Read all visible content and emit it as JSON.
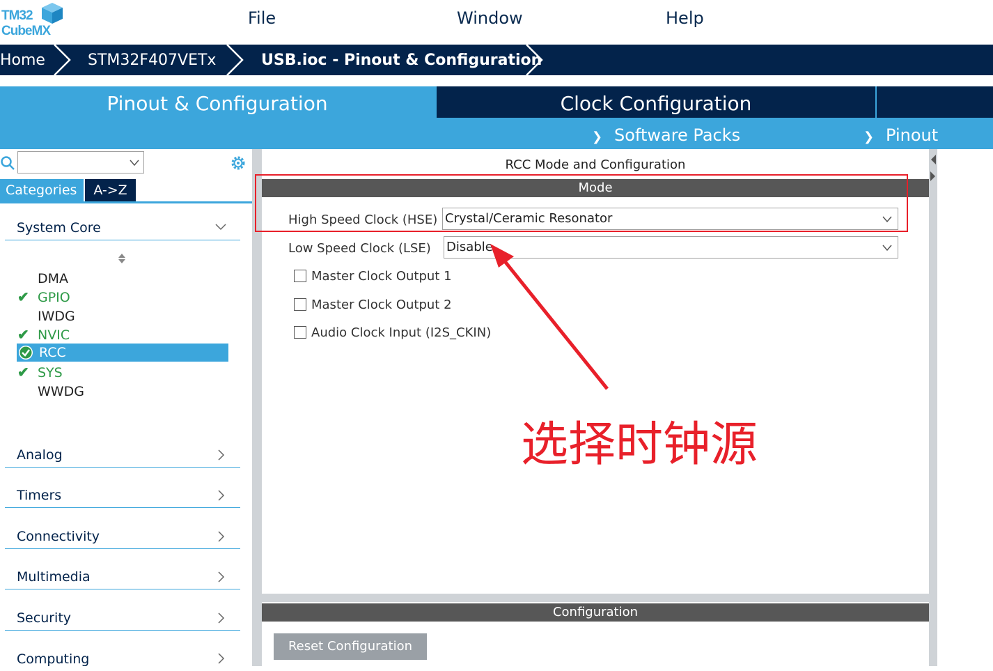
{
  "app": {
    "logo_line1": "TM32",
    "logo_line2": "CubeMX",
    "menu": [
      "File",
      "Window",
      "Help"
    ]
  },
  "breadcrumb": [
    "Home",
    "STM32F407VETx",
    "USB.ioc - Pinout & Configuration"
  ],
  "tabs": {
    "pinout": "Pinout & Configuration",
    "clock": "Clock Configuration",
    "software_packs": "Software Packs",
    "pinout_menu": "Pinout"
  },
  "left": {
    "search": {
      "value": ""
    },
    "view_tabs": [
      "Categories",
      "A->Z"
    ],
    "categories": [
      {
        "label": "System Core"
      },
      {
        "label": "Analog"
      },
      {
        "label": "Timers"
      },
      {
        "label": "Connectivity"
      },
      {
        "label": "Multimedia"
      },
      {
        "label": "Security"
      },
      {
        "label": "Computing"
      }
    ],
    "system_core_items": [
      {
        "label": "DMA",
        "status": "none"
      },
      {
        "label": "GPIO",
        "status": "ok"
      },
      {
        "label": "IWDG",
        "status": "none"
      },
      {
        "label": "NVIC",
        "status": "ok"
      },
      {
        "label": "RCC",
        "status": "selected"
      },
      {
        "label": "SYS",
        "status": "ok"
      },
      {
        "label": "WWDG",
        "status": "none"
      }
    ]
  },
  "right": {
    "title": "RCC Mode and Configuration",
    "mode_header": "Mode",
    "hse": {
      "label": "High Speed Clock (HSE)",
      "value": "Crystal/Ceramic Resonator"
    },
    "lse": {
      "label": "Low Speed Clock (LSE)",
      "value": "Disable"
    },
    "checkboxes": [
      "Master Clock Output 1",
      "Master Clock Output 2",
      "Audio Clock Input (I2S_CKIN)"
    ],
    "config_header": "Configuration",
    "reset_button": "Reset Configuration"
  },
  "annotation": {
    "text": "选择时钟源",
    "color": "#e8202a"
  },
  "colors": {
    "navy": "#03234b",
    "accent": "#3ca6dc",
    "ok_green": "#2e9a47",
    "header_gray": "#575757"
  }
}
